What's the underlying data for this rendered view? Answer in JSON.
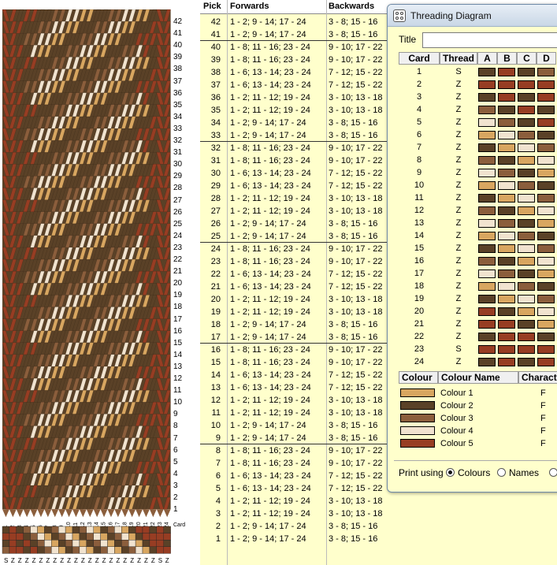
{
  "colors": {
    "colour1": "#d8a660",
    "colour2": "#5a4127",
    "colour3": "#8b5e3c",
    "colour4": "#f1e3cf",
    "colour5": "#973d23"
  },
  "weave": {
    "card_label": "Card",
    "pick_numbers": [
      "42",
      "41",
      "40",
      "39",
      "38",
      "37",
      "36",
      "35",
      "34",
      "33",
      "32",
      "31",
      "30",
      "29",
      "28",
      "27",
      "26",
      "25",
      "24",
      "23",
      "22",
      "21",
      "20",
      "19",
      "18",
      "17",
      "16",
      "15",
      "14",
      "13",
      "12",
      "11",
      "10",
      "9",
      "8",
      "7",
      "6",
      "5",
      "4",
      "3",
      "2",
      "1"
    ],
    "threading_letters": [
      "S",
      "Z",
      "Z",
      "Z",
      "Z",
      "Z",
      "Z",
      "Z",
      "Z",
      "Z",
      "Z",
      "Z",
      "Z",
      "Z",
      "Z",
      "Z",
      "Z",
      "Z",
      "Z",
      "Z",
      "Z",
      "Z",
      "S",
      "Z"
    ]
  },
  "table": {
    "headers": {
      "pick": "Pick",
      "forwards": "Forwards",
      "backwards": "Backwards"
    },
    "rows": [
      {
        "pick": "42",
        "forwards": "1 - 2; 9 - 14; 17 - 24",
        "backwards": "3 - 8; 15 - 16"
      },
      {
        "pick": "41",
        "forwards": "1 - 2; 9 - 14; 17 - 24",
        "backwards": "3 - 8; 15 - 16"
      },
      {
        "pick": "40",
        "forwards": "1 - 8; 11 - 16; 23 - 24",
        "backwards": "9 - 10; 17 - 22"
      },
      {
        "pick": "39",
        "forwards": "1 - 8; 11 - 16; 23 - 24",
        "backwards": "9 - 10; 17 - 22"
      },
      {
        "pick": "38",
        "forwards": "1 - 6; 13 - 14; 23 - 24",
        "backwards": "7 - 12; 15 - 22"
      },
      {
        "pick": "37",
        "forwards": "1 - 6; 13 - 14; 23 - 24",
        "backwards": "7 - 12; 15 - 22"
      },
      {
        "pick": "36",
        "forwards": "1 - 2; 11 - 12; 19 - 24",
        "backwards": "3 - 10; 13 - 18"
      },
      {
        "pick": "35",
        "forwards": "1 - 2; 11 - 12; 19 - 24",
        "backwards": "3 - 10; 13 - 18"
      },
      {
        "pick": "34",
        "forwards": "1 - 2; 9 - 14; 17 - 24",
        "backwards": "3 - 8; 15 - 16"
      },
      {
        "pick": "33",
        "forwards": "1 - 2; 9 - 14; 17 - 24",
        "backwards": "3 - 8; 15 - 16"
      },
      {
        "pick": "32",
        "forwards": "1 - 8; 11 - 16; 23 - 24",
        "backwards": "9 - 10; 17 - 22"
      },
      {
        "pick": "31",
        "forwards": "1 - 8; 11 - 16; 23 - 24",
        "backwards": "9 - 10; 17 - 22"
      },
      {
        "pick": "30",
        "forwards": "1 - 6; 13 - 14; 23 - 24",
        "backwards": "7 - 12; 15 - 22"
      },
      {
        "pick": "29",
        "forwards": "1 - 6; 13 - 14; 23 - 24",
        "backwards": "7 - 12; 15 - 22"
      },
      {
        "pick": "28",
        "forwards": "1 - 2; 11 - 12; 19 - 24",
        "backwards": "3 - 10; 13 - 18"
      },
      {
        "pick": "27",
        "forwards": "1 - 2; 11 - 12; 19 - 24",
        "backwards": "3 - 10; 13 - 18"
      },
      {
        "pick": "26",
        "forwards": "1 - 2; 9 - 14; 17 - 24",
        "backwards": "3 - 8; 15 - 16"
      },
      {
        "pick": "25",
        "forwards": "1 - 2; 9 - 14; 17 - 24",
        "backwards": "3 - 8; 15 - 16"
      },
      {
        "pick": "24",
        "forwards": "1 - 8; 11 - 16; 23 - 24",
        "backwards": "9 - 10; 17 - 22"
      },
      {
        "pick": "23",
        "forwards": "1 - 8; 11 - 16; 23 - 24",
        "backwards": "9 - 10; 17 - 22"
      },
      {
        "pick": "22",
        "forwards": "1 - 6; 13 - 14; 23 - 24",
        "backwards": "7 - 12; 15 - 22"
      },
      {
        "pick": "21",
        "forwards": "1 - 6; 13 - 14; 23 - 24",
        "backwards": "7 - 12; 15 - 22"
      },
      {
        "pick": "20",
        "forwards": "1 - 2; 11 - 12; 19 - 24",
        "backwards": "3 - 10; 13 - 18"
      },
      {
        "pick": "19",
        "forwards": "1 - 2; 11 - 12; 19 - 24",
        "backwards": "3 - 10; 13 - 18"
      },
      {
        "pick": "18",
        "forwards": "1 - 2; 9 - 14; 17 - 24",
        "backwards": "3 - 8; 15 - 16"
      },
      {
        "pick": "17",
        "forwards": "1 - 2; 9 - 14; 17 - 24",
        "backwards": "3 - 8; 15 - 16"
      },
      {
        "pick": "16",
        "forwards": "1 - 8; 11 - 16; 23 - 24",
        "backwards": "9 - 10; 17 - 22"
      },
      {
        "pick": "15",
        "forwards": "1 - 8; 11 - 16; 23 - 24",
        "backwards": "9 - 10; 17 - 22"
      },
      {
        "pick": "14",
        "forwards": "1 - 6; 13 - 14; 23 - 24",
        "backwards": "7 - 12; 15 - 22"
      },
      {
        "pick": "13",
        "forwards": "1 - 6; 13 - 14; 23 - 24",
        "backwards": "7 - 12; 15 - 22"
      },
      {
        "pick": "12",
        "forwards": "1 - 2; 11 - 12; 19 - 24",
        "backwards": "3 - 10; 13 - 18"
      },
      {
        "pick": "11",
        "forwards": "1 - 2; 11 - 12; 19 - 24",
        "backwards": "3 - 10; 13 - 18"
      },
      {
        "pick": "10",
        "forwards": "1 - 2; 9 - 14; 17 - 24",
        "backwards": "3 - 8; 15 - 16"
      },
      {
        "pick": "9",
        "forwards": "1 - 2; 9 - 14; 17 - 24",
        "backwards": "3 - 8; 15 - 16"
      },
      {
        "pick": "8",
        "forwards": "1 - 8; 11 - 16; 23 - 24",
        "backwards": "9 - 10; 17 - 22"
      },
      {
        "pick": "7",
        "forwards": "1 - 8; 11 - 16; 23 - 24",
        "backwards": "9 - 10; 17 - 22"
      },
      {
        "pick": "6",
        "forwards": "1 - 6; 13 - 14; 23 - 24",
        "backwards": "7 - 12; 15 - 22"
      },
      {
        "pick": "5",
        "forwards": "1 - 6; 13 - 14; 23 - 24",
        "backwards": "7 - 12; 15 - 22"
      },
      {
        "pick": "4",
        "forwards": "1 - 2; 11 - 12; 19 - 24",
        "backwards": "3 - 10; 13 - 18"
      },
      {
        "pick": "3",
        "forwards": "1 - 2; 11 - 12; 19 - 24",
        "backwards": "3 - 10; 13 - 18"
      },
      {
        "pick": "2",
        "forwards": "1 - 2; 9 - 14; 17 - 24",
        "backwards": "3 - 8; 15 - 16"
      },
      {
        "pick": "1",
        "forwards": "1 - 2; 9 - 14; 17 - 24",
        "backwards": "3 - 8; 15 - 16"
      }
    ]
  },
  "dialog": {
    "title": "Threading Diagram",
    "title_label": "Title",
    "title_value": "",
    "headers": {
      "card": "Card",
      "thread": "Thread",
      "a": "A",
      "b": "B",
      "c": "C",
      "d": "D"
    },
    "cards": [
      {
        "card": "1",
        "thread": "S",
        "holes": [
          2,
          5,
          2,
          3
        ]
      },
      {
        "card": "2",
        "thread": "Z",
        "holes": [
          5,
          5,
          5,
          5
        ]
      },
      {
        "card": "3",
        "thread": "Z",
        "holes": [
          2,
          5,
          2,
          5
        ]
      },
      {
        "card": "4",
        "thread": "Z",
        "holes": [
          3,
          2,
          5,
          2
        ]
      },
      {
        "card": "5",
        "thread": "Z",
        "holes": [
          4,
          3,
          2,
          5
        ]
      },
      {
        "card": "6",
        "thread": "Z",
        "holes": [
          1,
          4,
          3,
          2
        ]
      },
      {
        "card": "7",
        "thread": "Z",
        "holes": [
          2,
          1,
          4,
          3
        ]
      },
      {
        "card": "8",
        "thread": "Z",
        "holes": [
          3,
          2,
          1,
          4
        ]
      },
      {
        "card": "9",
        "thread": "Z",
        "holes": [
          4,
          3,
          2,
          1
        ]
      },
      {
        "card": "10",
        "thread": "Z",
        "holes": [
          1,
          4,
          3,
          2
        ]
      },
      {
        "card": "11",
        "thread": "Z",
        "holes": [
          2,
          1,
          4,
          3
        ]
      },
      {
        "card": "12",
        "thread": "Z",
        "holes": [
          3,
          2,
          1,
          4
        ]
      },
      {
        "card": "13",
        "thread": "Z",
        "holes": [
          4,
          3,
          2,
          1
        ]
      },
      {
        "card": "14",
        "thread": "Z",
        "holes": [
          1,
          4,
          3,
          2
        ]
      },
      {
        "card": "15",
        "thread": "Z",
        "holes": [
          2,
          1,
          4,
          3
        ]
      },
      {
        "card": "16",
        "thread": "Z",
        "holes": [
          3,
          2,
          1,
          4
        ]
      },
      {
        "card": "17",
        "thread": "Z",
        "holes": [
          4,
          3,
          2,
          1
        ]
      },
      {
        "card": "18",
        "thread": "Z",
        "holes": [
          1,
          4,
          3,
          2
        ]
      },
      {
        "card": "19",
        "thread": "Z",
        "holes": [
          2,
          1,
          4,
          3
        ]
      },
      {
        "card": "20",
        "thread": "Z",
        "holes": [
          5,
          2,
          1,
          4
        ]
      },
      {
        "card": "21",
        "thread": "Z",
        "holes": [
          5,
          5,
          2,
          1
        ]
      },
      {
        "card": "22",
        "thread": "Z",
        "holes": [
          2,
          5,
          5,
          2
        ]
      },
      {
        "card": "23",
        "thread": "S",
        "holes": [
          5,
          5,
          5,
          5
        ]
      },
      {
        "card": "24",
        "thread": "Z",
        "holes": [
          2,
          5,
          2,
          5
        ]
      }
    ],
    "colour_headers": {
      "colour": "Colour",
      "name": "Colour Name",
      "character": "Characte"
    },
    "colours": [
      {
        "name": "Colour 1",
        "character": "F",
        "color": "#d8a660"
      },
      {
        "name": "Colour 2",
        "character": "F",
        "color": "#5a4127"
      },
      {
        "name": "Colour 3",
        "character": "F",
        "color": "#8b5e3c"
      },
      {
        "name": "Colour 4",
        "character": "F",
        "color": "#f1e3cf"
      },
      {
        "name": "Colour 5",
        "character": "F",
        "color": "#973d23"
      }
    ],
    "print_label": "Print using",
    "print_options": [
      {
        "label": "Colours",
        "selected": true
      },
      {
        "label": "Names",
        "selected": false
      }
    ]
  }
}
